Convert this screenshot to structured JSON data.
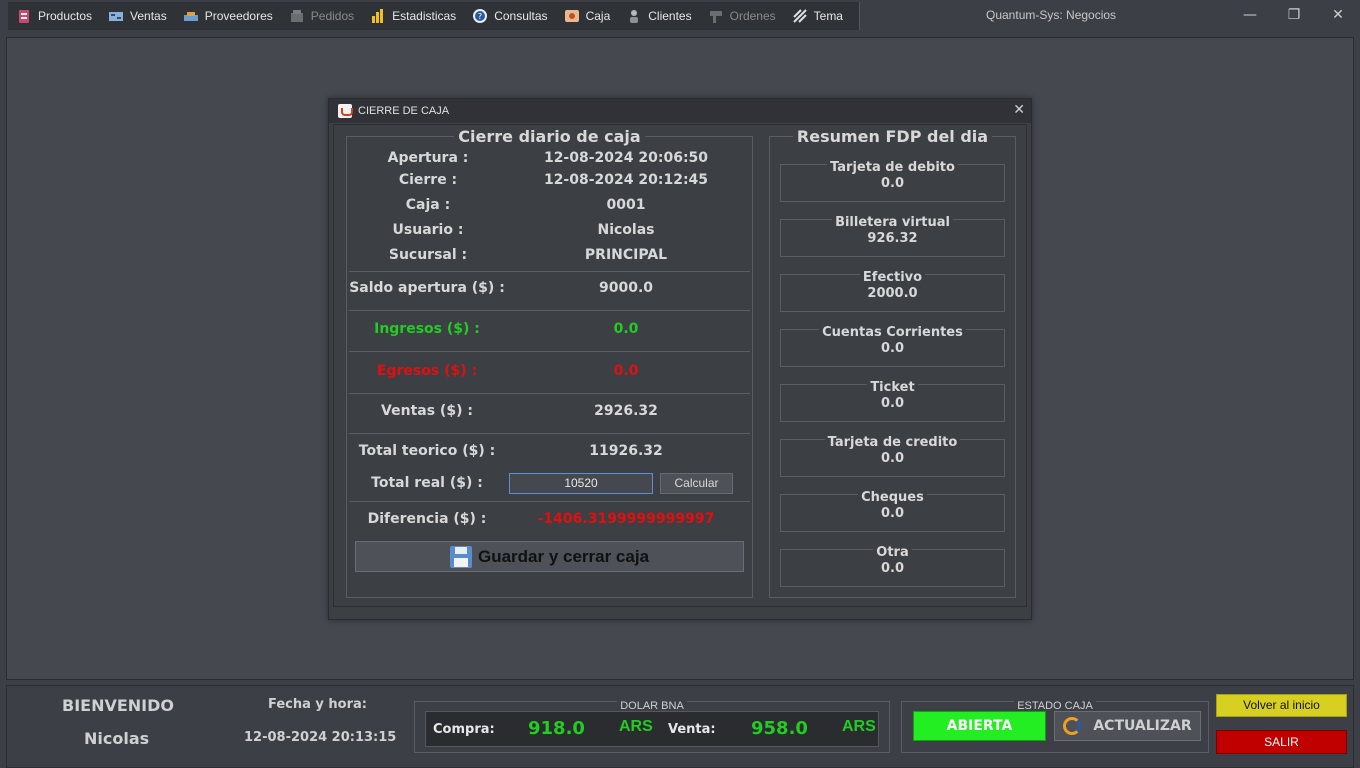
{
  "window": {
    "title": "Quantum-Sys: Negocios"
  },
  "menu": [
    {
      "label": "Productos",
      "icon": "productos-icon",
      "enabled": true
    },
    {
      "label": "Ventas",
      "icon": "ventas-icon",
      "enabled": true
    },
    {
      "label": "Proveedores",
      "icon": "proveedores-icon",
      "enabled": true
    },
    {
      "label": "Pedidos",
      "icon": "pedidos-icon",
      "enabled": false
    },
    {
      "label": "Estadisticas",
      "icon": "estadisticas-icon",
      "enabled": true
    },
    {
      "label": "Consultas",
      "icon": "consultas-icon",
      "enabled": true
    },
    {
      "label": "Caja",
      "icon": "caja-icon",
      "enabled": true
    },
    {
      "label": "Clientes",
      "icon": "clientes-icon",
      "enabled": true
    },
    {
      "label": "Ordenes",
      "icon": "ordenes-icon",
      "enabled": false
    },
    {
      "label": "Tema",
      "icon": "tema-icon",
      "enabled": true
    }
  ],
  "dialog": {
    "title": "CIERRE DE CAJA",
    "left_title": "Cierre diario de caja",
    "apertura_label": "Apertura :",
    "apertura_val": "12-08-2024 20:06:50",
    "cierre_label": "Cierre :",
    "cierre_val": "12-08-2024 20:12:45",
    "caja_label": "Caja :",
    "caja_val": "0001",
    "usuario_label": "Usuario :",
    "usuario_val": "Nicolas",
    "sucursal_label": "Sucursal :",
    "sucursal_val": "PRINCIPAL",
    "saldo_label": "Saldo apertura ($) :",
    "saldo_val": "9000.0",
    "ingresos_label": "Ingresos ($) :",
    "ingresos_val": "0.0",
    "egresos_label": "Egresos ($) :",
    "egresos_val": "0.0",
    "ventas_label": "Ventas ($) :",
    "ventas_val": "2926.32",
    "teorico_label": "Total teorico ($) :",
    "teorico_val": "11926.32",
    "real_label": "Total real ($) :",
    "real_input": "10520",
    "calcular_label": "Calcular",
    "diferencia_label": "Diferencia ($) :",
    "diferencia_val": "-1406.3199999999997",
    "guardar_label": "Guardar y cerrar caja",
    "right_title": "Resumen FDP del dia",
    "fdp": [
      {
        "label": "Tarjeta de debito",
        "value": "0.0"
      },
      {
        "label": "Billetera virtual",
        "value": "926.32"
      },
      {
        "label": "Efectivo",
        "value": "2000.0"
      },
      {
        "label": "Cuentas Corrientes",
        "value": "0.0"
      },
      {
        "label": "Ticket",
        "value": "0.0"
      },
      {
        "label": "Tarjeta de credito",
        "value": "0.0"
      },
      {
        "label": "Cheques",
        "value": "0.0"
      },
      {
        "label": "Otra",
        "value": "0.0"
      }
    ]
  },
  "status": {
    "welcome": "BIENVENIDO",
    "user": "Nicolas",
    "fecha_label": "Fecha y hora:",
    "fecha_val": "12-08-2024 20:13:15",
    "dolar_title": "DOLAR BNA",
    "compra_label": "Compra:",
    "compra_val": "918.0",
    "venta_label": "Venta:",
    "venta_val": "958.0",
    "currency": "ARS",
    "estado_title": "ESTADO CAJA",
    "estado_val": "ABIERTA",
    "actualizar_label": "ACTUALIZAR",
    "volver_label": "Volver al inicio",
    "salir_label": "SALIR"
  },
  "colors": {
    "green": "#22cc22",
    "red": "#e01010",
    "abierta": "#22ee22",
    "volver": "#d8d020",
    "salir": "#c00000"
  }
}
